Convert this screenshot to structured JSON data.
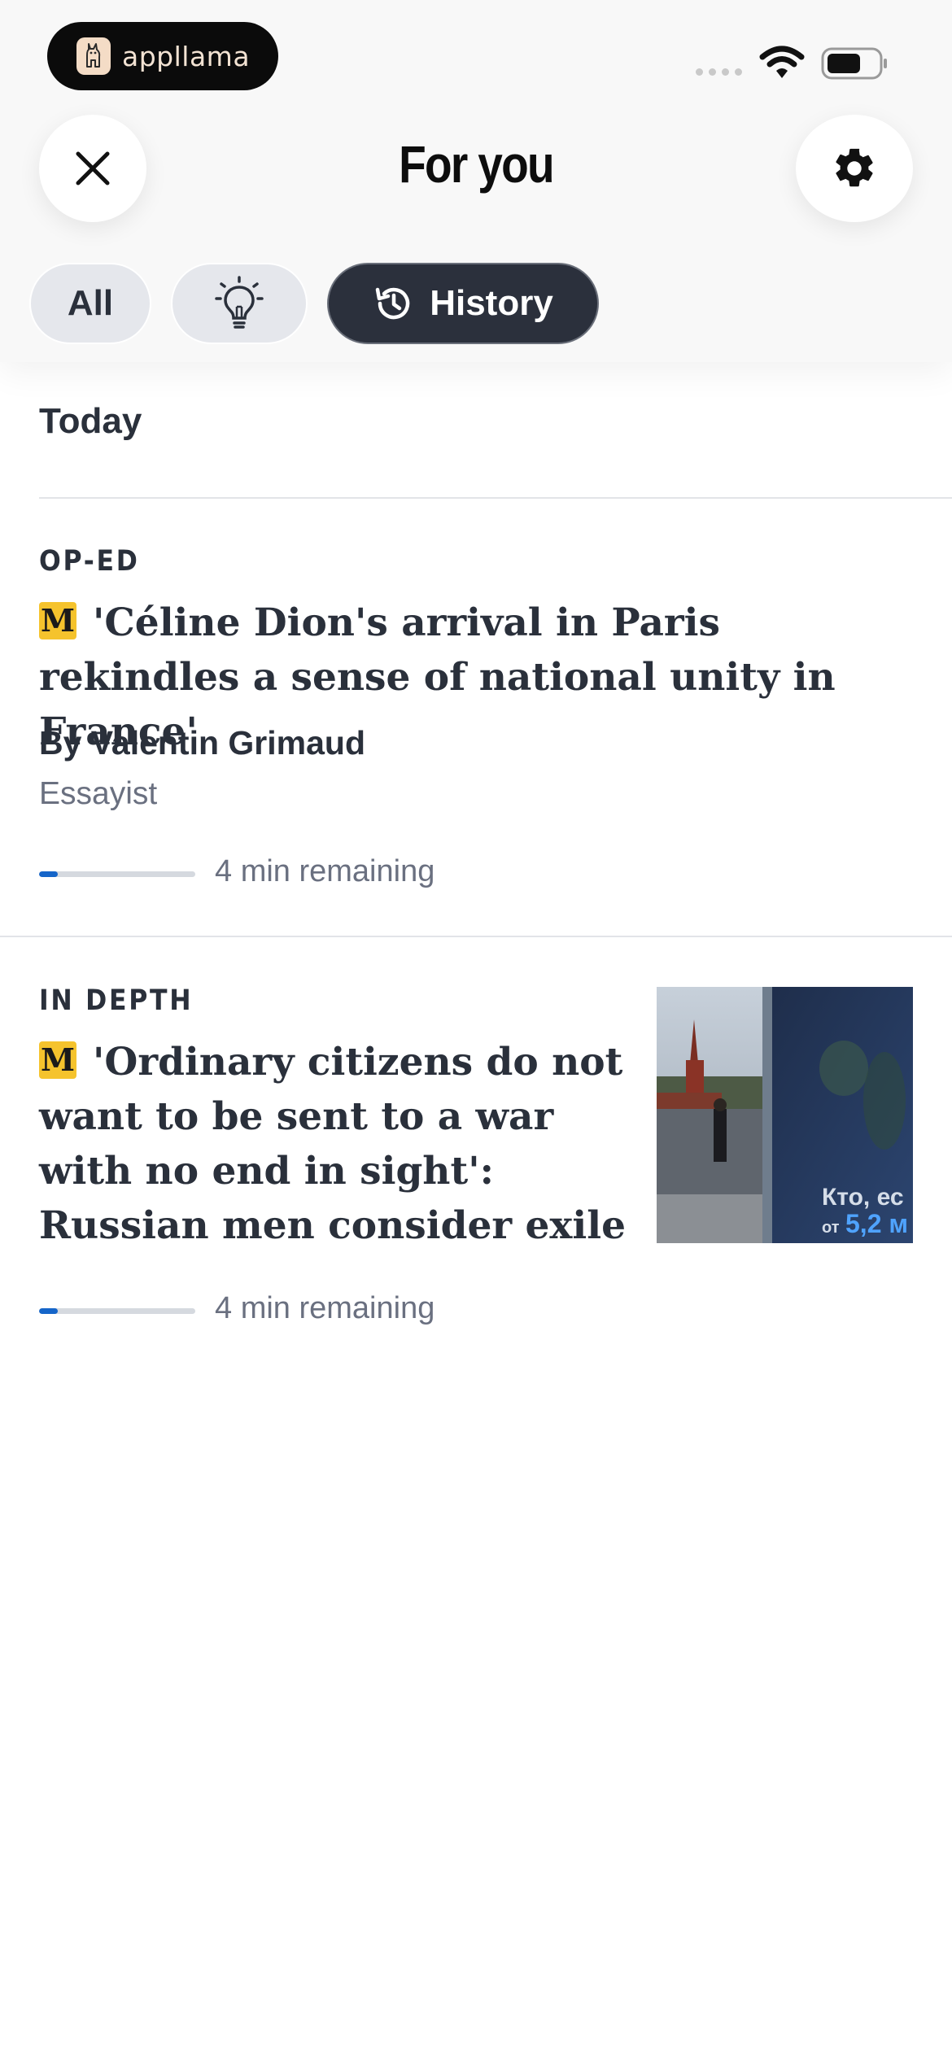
{
  "status_bar": {
    "brand": "appllama"
  },
  "header": {
    "title": "For you"
  },
  "tabs": [
    {
      "label": "All",
      "active": false
    },
    {
      "label": "",
      "icon": "lightbulb-icon",
      "active": false
    },
    {
      "label": "History",
      "icon": "history-icon",
      "active": true
    }
  ],
  "section": {
    "title": "Today"
  },
  "articles": [
    {
      "kicker": "OP-ED",
      "badge": "M",
      "headline": "'Céline Dion's arrival in Paris rekindles a sense of national unity in France'",
      "byline": "By Valentin Grimaud",
      "role": "Essayist",
      "progress": 0.12,
      "remaining": "4 min remaining"
    },
    {
      "kicker": "IN DEPTH",
      "badge": "M",
      "headline": "'Ordinary citizens do not want to be sent to a war with no end in sight': Russian men consider exile",
      "remaining": "4 min remaining",
      "progress": 0.12,
      "thumbnail_text": [
        "Кто, ес",
        "от",
        "5,2 м"
      ]
    }
  ],
  "colors": {
    "accent": "#1565c9",
    "badge": "#f5c32d",
    "active_tab": "#2b303c",
    "text": "#2a303b",
    "muted": "#6a7080"
  }
}
